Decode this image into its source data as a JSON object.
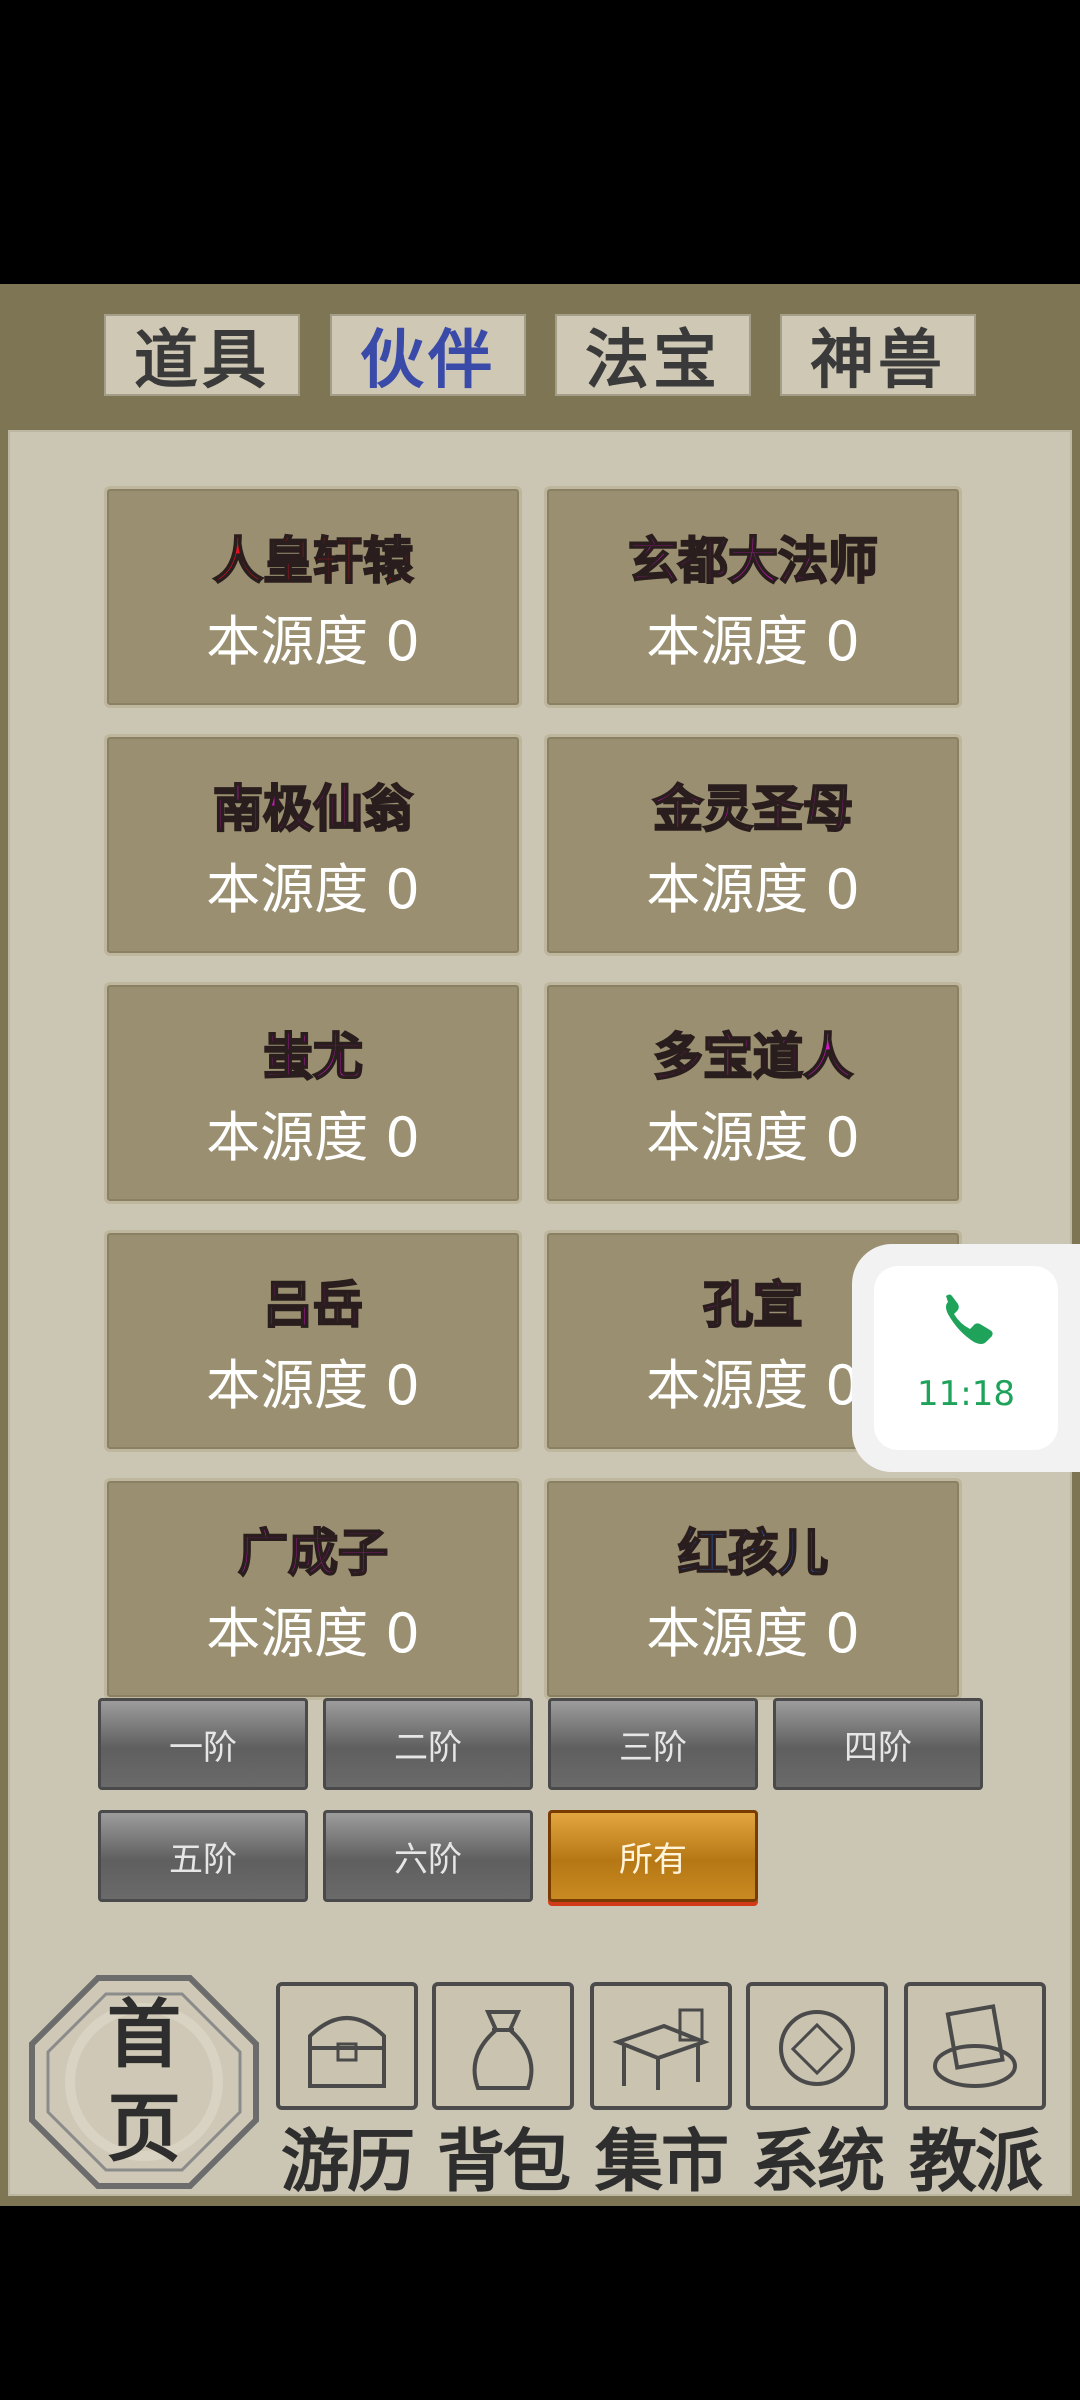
{
  "tabs": [
    {
      "label": "道具"
    },
    {
      "label": "伙伴"
    },
    {
      "label": "法宝"
    },
    {
      "label": "神兽"
    }
  ],
  "source_label": "本源度 0",
  "partners": [
    {
      "name": "人皇轩辕",
      "color": "#e8101e"
    },
    {
      "name": "玄都大法师",
      "color": "#d016c8"
    },
    {
      "name": "南极仙翁",
      "color": "#d016c8"
    },
    {
      "name": "金灵圣母",
      "color": "#d016c8"
    },
    {
      "name": "蚩尤",
      "color": "#d016c8"
    },
    {
      "name": "多宝道人",
      "color": "#d016c8"
    },
    {
      "name": "吕岳",
      "color": "#d016c8"
    },
    {
      "name": "孔宣",
      "color": "#d016c8"
    },
    {
      "name": "广成子",
      "color": "#d016c8"
    },
    {
      "name": "红孩儿",
      "color": "#2a6ef0"
    }
  ],
  "tiers": [
    {
      "label": "一阶"
    },
    {
      "label": "二阶"
    },
    {
      "label": "三阶"
    },
    {
      "label": "四阶"
    },
    {
      "label": "五阶"
    },
    {
      "label": "六阶"
    },
    {
      "label": "所有",
      "selected": true
    }
  ],
  "nav": {
    "home": "首页",
    "items": [
      {
        "label": "游历",
        "icon": "chest-icon"
      },
      {
        "label": "背包",
        "icon": "bag-icon"
      },
      {
        "label": "集市",
        "icon": "market-stall-icon"
      },
      {
        "label": "系统",
        "icon": "system-seal-icon"
      },
      {
        "label": "教派",
        "icon": "sect-scroll-icon"
      }
    ]
  },
  "call_overlay": {
    "time": "11:18",
    "icon": "phone-icon",
    "accent": "#1fa35a"
  }
}
